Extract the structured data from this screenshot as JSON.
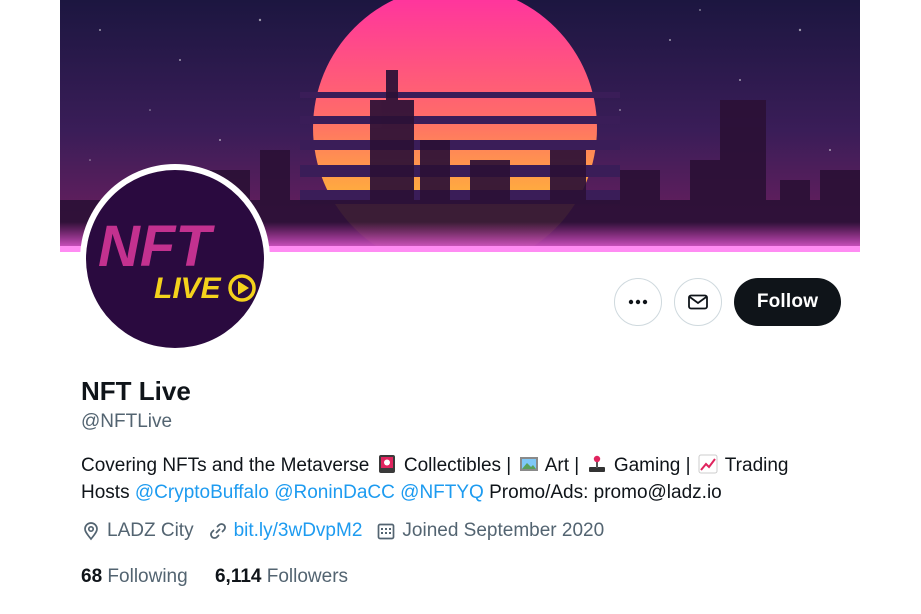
{
  "profile": {
    "name": "NFT Live",
    "handle": "@NFTLive",
    "avatar_text_top": "NFT",
    "avatar_text_bottom": "LIVE"
  },
  "actions": {
    "follow_label": "Follow",
    "more_icon": "more-horizontal-icon",
    "message_icon": "envelope-icon"
  },
  "bio": {
    "line1": {
      "text1": "Covering NFTs and the Metaverse",
      "text2": "Collectibles |",
      "text3": "Art |",
      "text4": "Gaming |",
      "text5": "Trading"
    },
    "line2": {
      "prefix": "Hosts",
      "mention1": "@CryptoBuffalo",
      "mention2": "@RoninDaCC",
      "mention3": "@NFTYQ",
      "suffix": "Promo/Ads: promo@ladz.io"
    }
  },
  "meta": {
    "location": "LADZ City",
    "link": "bit.ly/3wDvpM2",
    "joined": "Joined September 2020"
  },
  "stats": {
    "following_count": "68",
    "following_label": "Following",
    "followers_count": "6,114",
    "followers_label": "Followers"
  },
  "colors": {
    "accent": "#1d9bf0",
    "text_primary": "#0f1419",
    "text_secondary": "#536471",
    "follow_bg": "#0f1419",
    "avatar_bg": "#2a0a3f",
    "avatar_magenta": "#c3318f",
    "avatar_yellow": "#f4d21c"
  }
}
